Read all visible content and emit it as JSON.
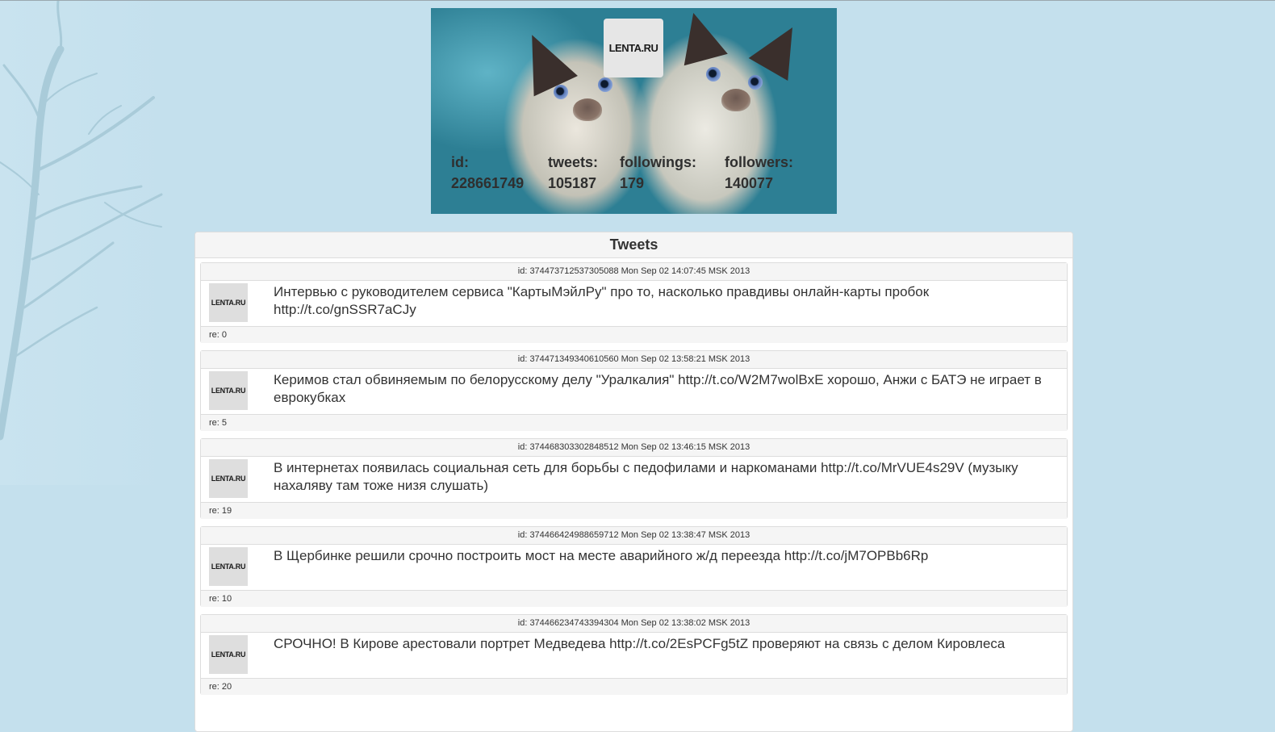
{
  "profile": {
    "logo_text": "LENTA.RU",
    "stats": [
      {
        "label": "id:",
        "value": "228661749"
      },
      {
        "label": "tweets:",
        "value": "105187"
      },
      {
        "label": "followings:",
        "value": "179"
      },
      {
        "label": "followers:",
        "value": "140077"
      }
    ]
  },
  "panel": {
    "title": "Tweets"
  },
  "tweets": [
    {
      "meta": "id: 374473712537305088 Mon Sep 02 14:07:45 MSK 2013",
      "avatar_text": "LENTA.RU",
      "text": "Интервью с руководителем сервиса \"КартыМэйлРу\" про то, насколько правдивы онлайн-карты пробок http://t.co/gnSSR7aCJy",
      "replies": "re: 0"
    },
    {
      "meta": "id: 374471349340610560 Mon Sep 02 13:58:21 MSK 2013",
      "avatar_text": "LENTA.RU",
      "text": "Керимов стал обвиняемым по белорусскому делу \"Уралкалия\" http://t.co/W2M7wolBxE хорошо, Анжи с БАТЭ не играет в еврокубках",
      "replies": "re: 5"
    },
    {
      "meta": "id: 374468303302848512 Mon Sep 02 13:46:15 MSK 2013",
      "avatar_text": "LENTA.RU",
      "text": "В интернетах появилась социальная сеть для борьбы с педофилами и наркоманами http://t.co/MrVUE4s29V (музыку нахаляву там тоже низя слушать)",
      "replies": "re: 19"
    },
    {
      "meta": "id: 374466424988659712 Mon Sep 02 13:38:47 MSK 2013",
      "avatar_text": "LENTA.RU",
      "text": "В Щербинке решили срочно построить мост на месте аварийного ж/д переезда http://t.co/jM7OPBb6Rp",
      "replies": "re: 10"
    },
    {
      "meta": "id: 374466234743394304 Mon Sep 02 13:38:02 MSK 2013",
      "avatar_text": "LENTA.RU",
      "text": "СРОЧНО! В Кирове арестовали портрет Медведева http://t.co/2EsPCFg5tZ проверяют на связь с делом Кировлеса",
      "replies": "re: 20"
    }
  ]
}
